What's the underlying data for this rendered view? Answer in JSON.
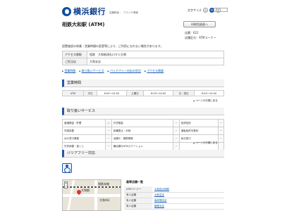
{
  "header": {
    "bank_name": "横浜銀行",
    "sub_text": "店舗検索 ｜ ブランチ情報",
    "font_size_label": "文字サイズ",
    "font_sizes": [
      "小",
      "中",
      "大"
    ],
    "print_button": "印刷用画面へ"
  },
  "page": {
    "title": "相鉄大和駅 (ATM)",
    "store_no": "店番：621",
    "store_type": "店舗区分：ATMコーナー",
    "notice": "設置施設の休業・営業時間の変更等により、ご利用になれない場合があります。"
  },
  "info": {
    "rows": [
      {
        "label": "アクセス情報",
        "value": "相鉄　大和駅改札口すぐ左側"
      },
      {
        "label": "ご担当店",
        "value": "大和支店"
      }
    ]
  },
  "links": [
    "営業時間",
    "取り扱いサービス",
    "バリアフリー対応の状況",
    "アクセス情報"
  ],
  "hours": {
    "title": "営業時間",
    "cells": [
      "ATM",
      "平日",
      "6:00～24:00",
      "土曜日",
      "6:00～24:00",
      "日・祝日",
      "6:00～24:00"
    ],
    "pagetop": "ページの先頭に戻る"
  },
  "services": {
    "title": "取り扱いサービス",
    "rows": [
      [
        "普通預金・貯蓄",
        "○",
        "外貨預金",
        "－",
        "投資信託",
        "－"
      ],
      [
        "外国為替",
        "－",
        "各種振込・手続",
        "－",
        "運転免許手数料",
        "－"
      ],
      [
        "ほか窓口業務",
        "－",
        "浜銀IC・連携業務",
        "－",
        "休日窓口",
        "－"
      ],
      [
        "外貨両替・宝くじ",
        "－",
        "横浜銀行ATMステーション",
        "－",
        "",
        ""
      ]
    ],
    "pagetop": "ページの先頭に戻る"
  },
  "barrier": {
    "title": "バリアフリー対応"
  },
  "map": {
    "labels": [
      "相鉄本線",
      "大和駅",
      "大和市2"
    ]
  },
  "side_table": {
    "caption": "最寄店舗一覧",
    "rows": [
      {
        "label": "ATMコーナー",
        "value": "大和西大和駅"
      },
      {
        "label": "有人店舗",
        "value": "大和支店"
      },
      {
        "label": "有人店舗",
        "value": "南林間支店"
      },
      {
        "label": "有人店舗",
        "value": "鶴間支店"
      }
    ]
  },
  "colors": {
    "brand": "#0b4fa1",
    "accent_bar": "#1f58a8",
    "link": "#1a5fb4"
  }
}
